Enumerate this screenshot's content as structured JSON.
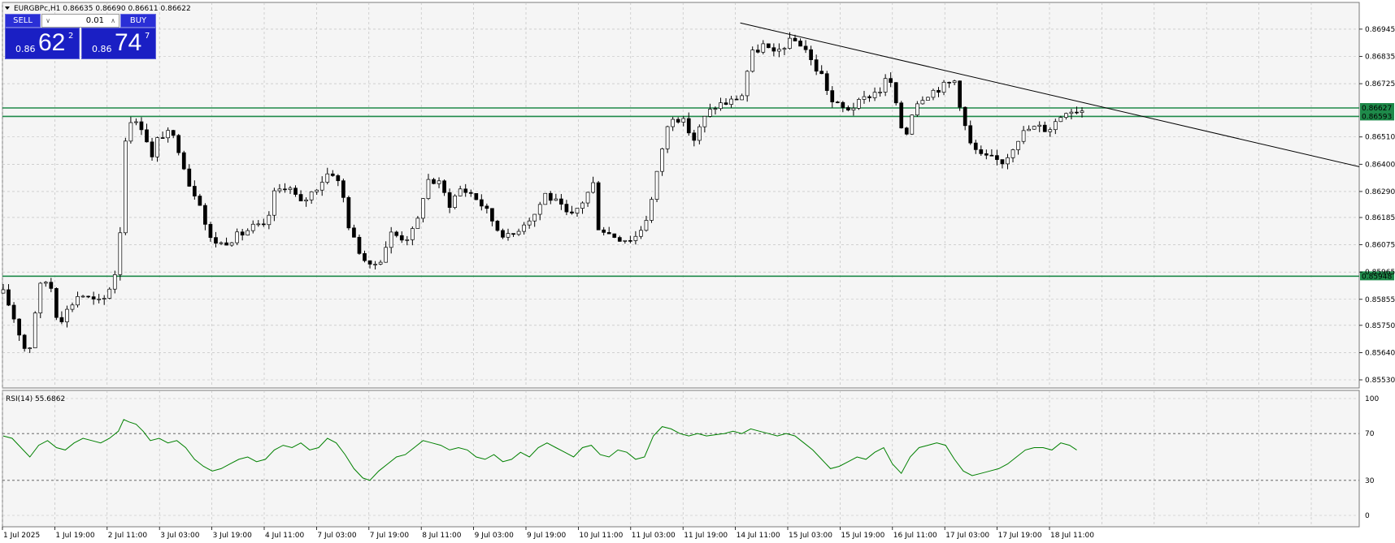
{
  "header": {
    "symbol": "EURGBPc,H1",
    "ohlc": "0.86635 0.86690 0.86611 0.86622"
  },
  "trade_panel": {
    "sell_label": "SELL",
    "buy_label": "BUY",
    "lot": "0.01",
    "sell": {
      "small": "0.86",
      "big": "62",
      "sup": "2"
    },
    "buy": {
      "small": "0.86",
      "big": "74",
      "sup": "7"
    }
  },
  "colors": {
    "background": "#f5f5f5",
    "grid": "#b9b9b9",
    "bull_candle": "#ffffff",
    "bear_candle": "#000000",
    "level_line": "#1e8a4a",
    "rsi_line": "#008000",
    "trendline": "#000000"
  },
  "chart_data": [
    {
      "type": "candlestick",
      "ylim": [
        0.8553,
        0.8702
      ],
      "y_ticks": [
        "0.86945",
        "0.86835",
        "0.86725",
        "0.86510",
        "0.86400",
        "0.86290",
        "0.86185",
        "0.86075",
        "0.85965",
        "0.85855",
        "0.85750",
        "0.85640",
        "0.85530"
      ],
      "x_ticks": [
        "1 Jul 2025",
        "1 Jul 19:00",
        "2 Jul 11:00",
        "3 Jul 03:00",
        "3 Jul 19:00",
        "4 Jul 11:00",
        "7 Jul 03:00",
        "7 Jul 19:00",
        "8 Jul 11:00",
        "9 Jul 03:00",
        "9 Jul 19:00",
        "10 Jul 11:00",
        "11 Jul 03:00",
        "11 Jul 19:00",
        "14 Jul 11:00",
        "15 Jul 03:00",
        "15 Jul 19:00",
        "16 Jul 11:00",
        "17 Jul 03:00",
        "17 Jul 19:00",
        "18 Jul 11:00"
      ],
      "horizontal_levels": [
        {
          "label": "0.86627",
          "value": 0.86627
        },
        {
          "label": "0.86593",
          "value": 0.86593
        },
        {
          "label": "0.85948",
          "value": 0.85948
        }
      ],
      "trendline": {
        "from": {
          "x": "14 Jul 11:00",
          "y": 0.8697
        },
        "to": {
          "x": "off-chart right",
          "y": 0.8639
        }
      },
      "close_path": [
        [
          0,
          0.8588
        ],
        [
          8,
          0.8582
        ],
        [
          18,
          0.8572
        ],
        [
          28,
          0.8562
        ],
        [
          40,
          0.859
        ],
        [
          52,
          0.8594
        ],
        [
          62,
          0.8576
        ],
        [
          74,
          0.8582
        ],
        [
          86,
          0.8588
        ],
        [
          100,
          0.8585
        ],
        [
          112,
          0.8584
        ],
        [
          122,
          0.8592
        ],
        [
          130,
          0.86
        ],
        [
          136,
          0.864
        ],
        [
          140,
          0.866
        ],
        [
          150,
          0.8656
        ],
        [
          160,
          0.8655
        ],
        [
          166,
          0.864
        ],
        [
          176,
          0.8652
        ],
        [
          190,
          0.8652
        ],
        [
          200,
          0.8645
        ],
        [
          210,
          0.8632
        ],
        [
          222,
          0.8625
        ],
        [
          232,
          0.861
        ],
        [
          246,
          0.8608
        ],
        [
          258,
          0.861
        ],
        [
          270,
          0.8612
        ],
        [
          284,
          0.8615
        ],
        [
          296,
          0.8614
        ],
        [
          306,
          0.8628
        ],
        [
          320,
          0.8632
        ],
        [
          336,
          0.8624
        ],
        [
          352,
          0.863
        ],
        [
          370,
          0.8638
        ],
        [
          382,
          0.863
        ],
        [
          392,
          0.8612
        ],
        [
          404,
          0.8604
        ],
        [
          414,
          0.8598
        ],
        [
          426,
          0.8602
        ],
        [
          438,
          0.8612
        ],
        [
          454,
          0.861
        ],
        [
          466,
          0.8614
        ],
        [
          478,
          0.8634
        ],
        [
          492,
          0.8632
        ],
        [
          504,
          0.8624
        ],
        [
          516,
          0.863
        ],
        [
          530,
          0.8628
        ],
        [
          544,
          0.8622
        ],
        [
          558,
          0.8614
        ],
        [
          572,
          0.861
        ],
        [
          586,
          0.8616
        ],
        [
          600,
          0.862
        ],
        [
          612,
          0.8628
        ],
        [
          626,
          0.8624
        ],
        [
          640,
          0.8618
        ],
        [
          654,
          0.8625
        ],
        [
          666,
          0.8632
        ],
        [
          672,
          0.8615
        ],
        [
          684,
          0.8612
        ],
        [
          698,
          0.861
        ],
        [
          712,
          0.861
        ],
        [
          724,
          0.8616
        ],
        [
          734,
          0.8628
        ],
        [
          742,
          0.8644
        ],
        [
          754,
          0.866
        ],
        [
          766,
          0.8658
        ],
        [
          780,
          0.865
        ],
        [
          794,
          0.866
        ],
        [
          806,
          0.8664
        ],
        [
          820,
          0.8665
        ],
        [
          834,
          0.8668
        ],
        [
          844,
          0.8684
        ],
        [
          858,
          0.8688
        ],
        [
          870,
          0.8684
        ],
        [
          882,
          0.8688
        ],
        [
          892,
          0.869
        ],
        [
          904,
          0.8688
        ],
        [
          914,
          0.868
        ],
        [
          924,
          0.8676
        ],
        [
          936,
          0.8665
        ],
        [
          950,
          0.8662
        ],
        [
          964,
          0.8664
        ],
        [
          978,
          0.8668
        ],
        [
          990,
          0.867
        ],
        [
          1000,
          0.8676
        ],
        [
          1010,
          0.866
        ],
        [
          1018,
          0.865
        ],
        [
          1028,
          0.8664
        ],
        [
          1040,
          0.8668
        ],
        [
          1052,
          0.867
        ],
        [
          1064,
          0.8672
        ],
        [
          1076,
          0.8674
        ],
        [
          1082,
          0.866
        ],
        [
          1092,
          0.8648
        ],
        [
          1104,
          0.8643
        ],
        [
          1116,
          0.8642
        ],
        [
          1130,
          0.8641
        ],
        [
          1144,
          0.865
        ],
        [
          1156,
          0.8654
        ],
        [
          1168,
          0.8655
        ],
        [
          1180,
          0.8654
        ],
        [
          1190,
          0.8658
        ],
        [
          1200,
          0.8662
        ],
        [
          1210,
          0.8662
        ],
        [
          1218,
          0.8662
        ]
      ]
    },
    {
      "type": "line",
      "title": "RSI(14) 55.6862",
      "ylim": [
        0,
        100
      ],
      "y_ticks": [
        "100",
        "70",
        "30",
        "0"
      ],
      "reference_levels": [
        70,
        30
      ],
      "series": [
        {
          "name": "RSI(14)",
          "x_index": [
            0,
            10,
            20,
            30,
            40,
            50,
            60,
            70,
            80,
            90,
            100,
            110,
            120,
            130,
            136,
            142,
            150,
            158,
            166,
            176,
            186,
            196,
            206,
            216,
            226,
            236,
            246,
            256,
            266,
            276,
            286,
            296,
            306,
            316,
            326,
            336,
            346,
            356,
            366,
            376,
            386,
            396,
            406,
            414,
            424,
            434,
            444,
            454,
            464,
            474,
            484,
            494,
            504,
            514,
            524,
            534,
            544,
            554,
            564,
            574,
            584,
            594,
            604,
            614,
            624,
            634,
            644,
            654,
            664,
            674,
            684,
            694,
            704,
            714,
            724,
            734,
            744,
            754,
            764,
            774,
            784,
            794,
            804,
            814,
            824,
            834,
            844,
            854,
            864,
            874,
            884,
            894,
            904,
            914,
            924,
            934,
            944,
            954,
            964,
            974,
            984,
            994,
            1004,
            1014,
            1024,
            1034,
            1044,
            1054,
            1064,
            1074,
            1084,
            1094,
            1104,
            1114,
            1124,
            1134,
            1144,
            1154,
            1164,
            1174,
            1184,
            1194,
            1204,
            1212
          ],
          "values": [
            68,
            66,
            58,
            50,
            60,
            64,
            58,
            56,
            62,
            66,
            64,
            62,
            66,
            72,
            82,
            80,
            78,
            72,
            64,
            66,
            62,
            64,
            58,
            48,
            42,
            38,
            40,
            44,
            48,
            50,
            46,
            48,
            56,
            60,
            58,
            62,
            56,
            58,
            66,
            62,
            52,
            40,
            32,
            30,
            38,
            44,
            50,
            52,
            58,
            64,
            62,
            60,
            56,
            58,
            56,
            50,
            48,
            52,
            46,
            48,
            54,
            50,
            58,
            62,
            58,
            54,
            50,
            58,
            60,
            52,
            50,
            56,
            54,
            48,
            50,
            68,
            76,
            74,
            70,
            68,
            70,
            68,
            69,
            70,
            72,
            70,
            74,
            72,
            70,
            68,
            70,
            68,
            62,
            56,
            48,
            40,
            42,
            46,
            50,
            48,
            54,
            58,
            44,
            36,
            50,
            58,
            60,
            62,
            60,
            48,
            38,
            34,
            36,
            38,
            40,
            44,
            50,
            56,
            58,
            58,
            56,
            62,
            60,
            56
          ]
        }
      ]
    }
  ]
}
